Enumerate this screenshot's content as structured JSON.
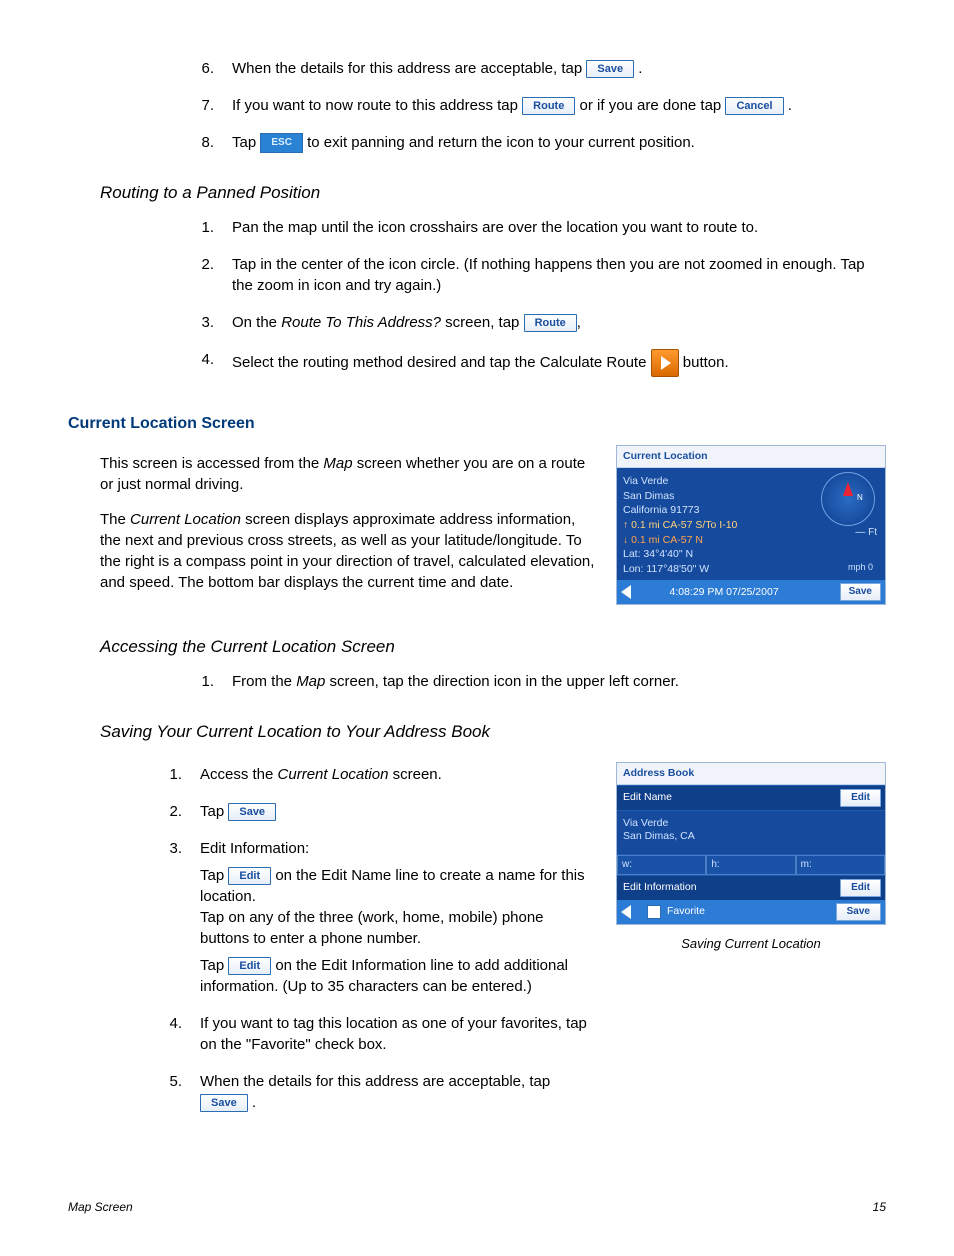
{
  "steps_top": {
    "s6_a": "When the details for this address are acceptable, tap ",
    "s6_b": ".",
    "s7_a": "If you want to now route to this address tap ",
    "s7_b": " or if you are done tap ",
    "s7_c": ".",
    "s8_a": "Tap ",
    "s8_b": " to exit panning and return the icon to your current position."
  },
  "btn": {
    "save": "Save",
    "route": "Route",
    "cancel": "Cancel",
    "esc": "ESC",
    "edit": "Edit"
  },
  "routing": {
    "title": "Routing to a Panned Position",
    "s1": "Pan the map until the icon crosshairs are over the location you want to route to.",
    "s2": "Tap in the center of the icon circle.  (If nothing happens then you are not zoomed in enough.  Tap the zoom in icon and try again.)",
    "s3_a": "On the ",
    "s3_b": "Route To This Address?",
    "s3_c": " screen, tap ",
    "s3_d": ",",
    "s4_a": "Select the routing method desired and tap the Calculate Route ",
    "s4_b": " button."
  },
  "cls": {
    "title": "Current Location Screen",
    "p1_a": "This screen is accessed from the ",
    "p1_b": "Map",
    "p1_c": " screen whether you are on a route or just normal driving.",
    "p2_a": "The ",
    "p2_b": "Current Location",
    "p2_c": " screen displays approximate address information, the next and previous cross streets, as well as your latitude/longitude.  To the right is a compass point in your direction of travel, calculated elevation, and speed.  The bottom bar displays the current time and date."
  },
  "cl_shot": {
    "head": "Current Location",
    "addr1": "Via Verde",
    "addr2": "San Dimas",
    "addr3": "California 91773",
    "up": "↑ 0.1 mi CA-57 S/To I-10",
    "dn": "↓ 0.1 mi CA-57 N",
    "lat": "Lat:  34°4'40\"  N",
    "lon": "Lon: 117°48'50\"  W",
    "elev": "— Ft",
    "mph": "mph\n0",
    "time": "4:08:29 PM  07/25/2007",
    "save": "Save"
  },
  "access": {
    "title": "Accessing the Current Location Screen",
    "s1_a": "From the ",
    "s1_b": "Map",
    "s1_c": " screen, tap the direction icon in the upper left corner."
  },
  "saving": {
    "title": "Saving Your Current Location to Your Address Book",
    "s1_a": "Access the ",
    "s1_b": "Current Location",
    "s1_c": " screen.",
    "s2_a": "Tap ",
    "s3": "Edit Information:",
    "s3a_a": "Tap ",
    "s3a_b": " on the Edit Name line to create a name for this location.",
    "s3b": "Tap on any of the three (work, home, mobile) phone buttons to enter a phone number.",
    "s3c_a": "Tap ",
    "s3c_b": " on the Edit Information line to add additional information.  (Up to 35 characters can be entered.)",
    "s4": "If you want to tag this location as one of your favorites, tap on the \"Favorite\" check box.",
    "s5_a": "When the details for this address are acceptable, tap ",
    "s5_b": "."
  },
  "ab_shot": {
    "head": "Address Book",
    "edit_name": "Edit Name",
    "addr1": "Via Verde",
    "addr2": "San Dimas, CA",
    "w": "w:",
    "h": "h:",
    "m": "m:",
    "edit_info": "Edit Information",
    "favorite": "Favorite",
    "edit": "Edit",
    "save": "Save",
    "caption": "Saving Current Location"
  },
  "footer": {
    "left": "Map Screen",
    "right": "15"
  }
}
